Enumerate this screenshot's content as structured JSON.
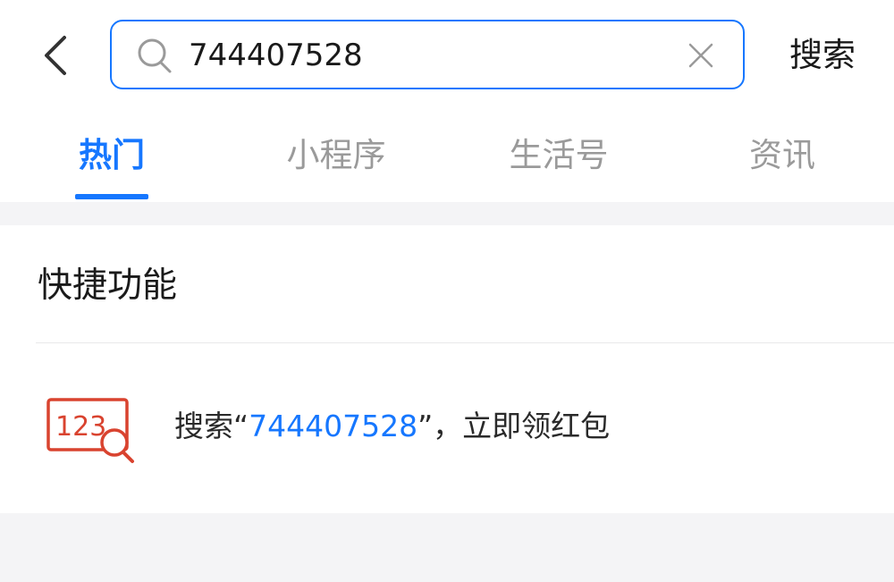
{
  "search": {
    "query": "744407528",
    "submit_label": "搜索"
  },
  "icons": {
    "back": "chevron-left-icon",
    "search": "search-icon",
    "clear": "close-icon",
    "quick": "number-search-icon"
  },
  "tabs": [
    {
      "label": "热门",
      "active": true
    },
    {
      "label": "小程序",
      "active": false
    },
    {
      "label": "生活号",
      "active": false
    },
    {
      "label": "资讯",
      "active": false
    }
  ],
  "quick_section": {
    "title": "快捷功能",
    "item": {
      "prefix": "搜索“",
      "highlight": "744407528",
      "suffix": "”，立即领红包",
      "icon_text": "123"
    }
  },
  "colors": {
    "accent": "#1677ff",
    "icon_red": "#d9432f",
    "inactive_tab": "#9a9a9a"
  }
}
